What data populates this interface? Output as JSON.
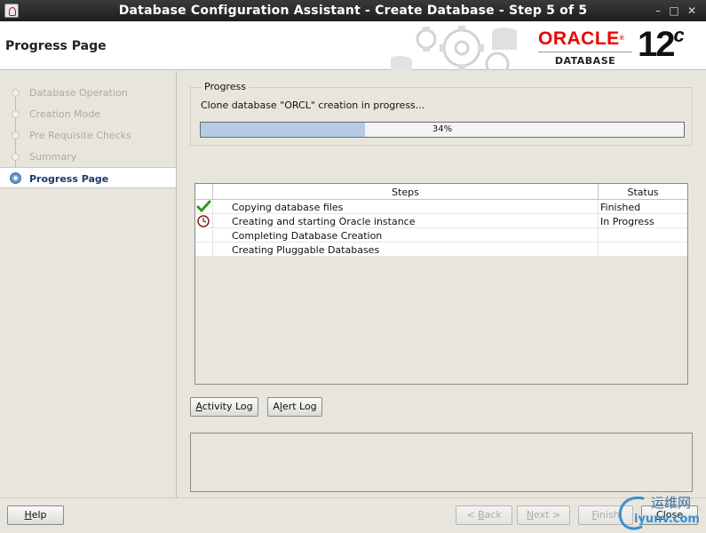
{
  "window": {
    "title": "Database Configuration Assistant - Create Database - Step 5 of 5",
    "controls": {
      "minimize": "–",
      "maximize": "□",
      "close": "✕"
    }
  },
  "header": {
    "page_heading": "Progress Page",
    "logo": {
      "brand": "ORACLE",
      "registered": "®",
      "product": "DATABASE",
      "version": "12",
      "version_suffix": "c"
    }
  },
  "nav": {
    "items": [
      {
        "label": "Database Operation",
        "state": "done"
      },
      {
        "label": "Creation Mode",
        "state": "done"
      },
      {
        "label": "Pre Requisite Checks",
        "state": "done"
      },
      {
        "label": "Summary",
        "state": "done"
      },
      {
        "label": "Progress Page",
        "state": "active"
      }
    ]
  },
  "progress": {
    "legend": "Progress",
    "message": "Clone database \"ORCL\" creation in progress...",
    "percent_label": "34%",
    "percent_value": 34
  },
  "steps_table": {
    "headers": {
      "steps": "Steps",
      "status": "Status"
    },
    "rows": [
      {
        "icon": "check-icon",
        "step": "Copying database files",
        "status": "Finished"
      },
      {
        "icon": "clock-icon",
        "step": "Creating and starting Oracle instance",
        "status": "In Progress"
      },
      {
        "icon": "",
        "step": "Completing Database Creation",
        "status": ""
      },
      {
        "icon": "",
        "step": "Creating Pluggable Databases",
        "status": ""
      }
    ]
  },
  "log_buttons": {
    "activity_log": {
      "mnemonic": "A",
      "rest": "ctivity Log"
    },
    "alert_log": {
      "pre": "A",
      "mnemonic": "l",
      "rest": "ert Log"
    }
  },
  "footer": {
    "help": {
      "mnemonic": "H",
      "rest": "elp"
    },
    "back": {
      "pre": "< ",
      "mnemonic": "B",
      "rest": "ack"
    },
    "next": {
      "mnemonic": "N",
      "rest": "ext >"
    },
    "finish": {
      "mnemonic": "F",
      "rest": "inish"
    },
    "close": {
      "mnemonic": "C",
      "rest": "lose"
    }
  },
  "watermark": {
    "cn": "运维网",
    "url": "iyunv.com"
  },
  "colors": {
    "titlebar": "#2b2b2b",
    "window_bg": "#e8e6dc",
    "progress_fill": "#b5cbe6",
    "nav_active_text": "#1a3b6c",
    "oracle_red": "#e00000",
    "check_green": "#2e9a1f"
  }
}
